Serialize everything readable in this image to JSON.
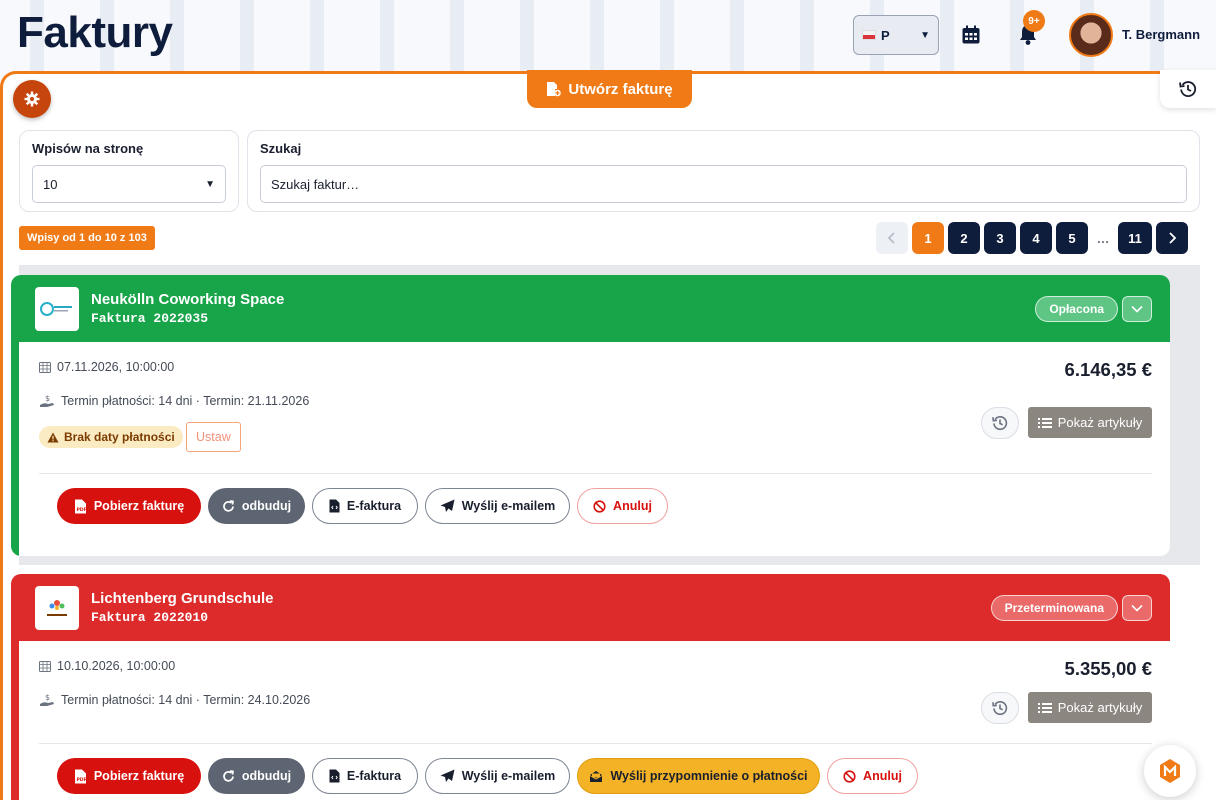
{
  "header": {
    "title": "Faktury",
    "language": "P",
    "notifications_badge": "9+",
    "username": "T. Bergmann"
  },
  "toolbar": {
    "create_invoice_label": "Utwórz fakturę"
  },
  "filters": {
    "per_page_label": "Wpisów na stronę",
    "per_page_value": "10",
    "search_label": "Szukaj",
    "search_placeholder": "Szukaj faktur…"
  },
  "pagination": {
    "entries_info": "Wpisy od 1 do 10 z 103",
    "pages": [
      "1",
      "2",
      "3",
      "4",
      "5"
    ],
    "ellipsis": "…",
    "last_page": "11",
    "current_page": "1"
  },
  "colors": {
    "accent": "#f07a15",
    "navy": "#0f1d3d",
    "paid": "#18a54a",
    "overdue": "#dd2a2a"
  },
  "invoices": [
    {
      "company": "Neukölln Coworking Space",
      "invoice_number": "Faktura 2022035",
      "status": "Opłacona",
      "date": "07.11.2026, 10:00:00",
      "payment_terms": "Termin płatności: 14 dni · Termin: 21.11.2026",
      "warning": "Brak daty płatności",
      "set_label": "Ustaw",
      "amount": "6.146,35 €",
      "items_label": "Pokaż artykuły",
      "actions": {
        "download": "Pobierz fakturę",
        "rebuild": "odbuduj",
        "einvoice": "E-faktura",
        "email": "Wyślij e-mailem",
        "cancel": "Anuluj"
      }
    },
    {
      "company": "Lichtenberg Grundschule",
      "invoice_number": "Faktura 2022010",
      "status": "Przeterminowana",
      "date": "10.10.2026, 10:00:00",
      "payment_terms": "Termin płatności: 14 dni · Termin: 24.10.2026",
      "amount": "5.355,00 €",
      "items_label": "Pokaż artykuły",
      "actions": {
        "download": "Pobierz fakturę",
        "rebuild": "odbuduj",
        "einvoice": "E-faktura",
        "email": "Wyślij e-mailem",
        "reminder": "Wyślij przypomnienie o płatności",
        "cancel": "Anuluj"
      }
    }
  ]
}
